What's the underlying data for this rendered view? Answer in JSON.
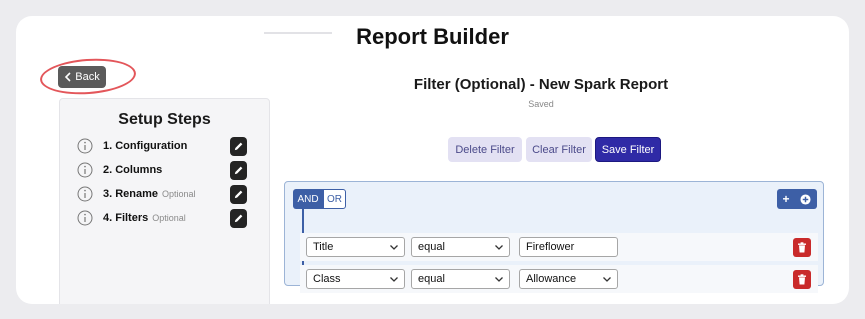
{
  "page": {
    "title": "Report Builder"
  },
  "back_button": {
    "label": "Back"
  },
  "sidebar": {
    "title": "Setup Steps",
    "steps": [
      {
        "label": "1. Configuration",
        "optional": ""
      },
      {
        "label": "2. Columns",
        "optional": ""
      },
      {
        "label": "3. Rename",
        "optional": "Optional"
      },
      {
        "label": "4. Filters",
        "optional": "Optional"
      }
    ]
  },
  "main": {
    "title": "Filter (Optional) - New Spark Report",
    "status": "Saved",
    "buttons": {
      "delete": "Delete Filter",
      "clear": "Clear Filter",
      "save": "Save Filter"
    }
  },
  "filter": {
    "and_label": "AND",
    "or_label": "OR",
    "add_rule_label": "+",
    "rules": [
      {
        "field": "Title",
        "operator": "equal",
        "value": "Fireflower"
      },
      {
        "field": "Class",
        "operator": "equal",
        "value": "Allowance"
      }
    ]
  },
  "colors": {
    "primary": "#2f2aa6",
    "light_button": "#e3e1f3",
    "group_blue": "#3d5fa6",
    "delete_red": "#c92a2a",
    "highlight_circle": "#e3565a"
  },
  "icons": [
    "chevron-left-icon",
    "info-icon",
    "pencil-icon",
    "plus-circle-icon",
    "trash-icon",
    "chevron-down-icon"
  ]
}
